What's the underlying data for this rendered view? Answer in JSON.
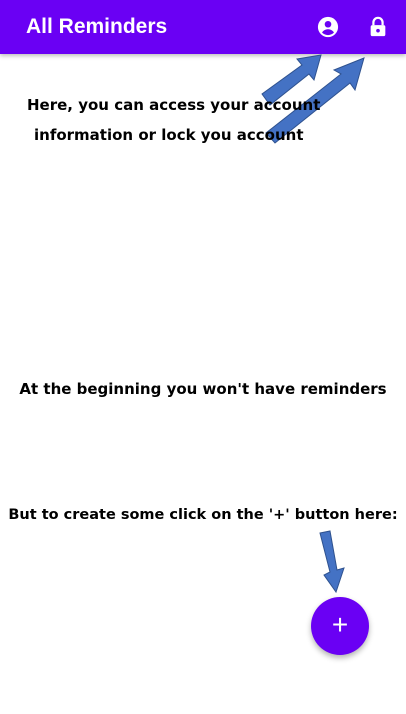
{
  "app_bar": {
    "title": "All Reminders",
    "account_icon": "account-circle-icon",
    "lock_icon": "lock-icon"
  },
  "annotations": {
    "line1": "Here, you can access your account",
    "line2": "information or lock you account",
    "empty_state": "At the beginning you won't have reminders",
    "create_hint": "But to create some click on the '+' button here:"
  },
  "fab": {
    "label": "+"
  },
  "colors": {
    "accent": "#6a00f4",
    "arrow": "#4472c4"
  }
}
